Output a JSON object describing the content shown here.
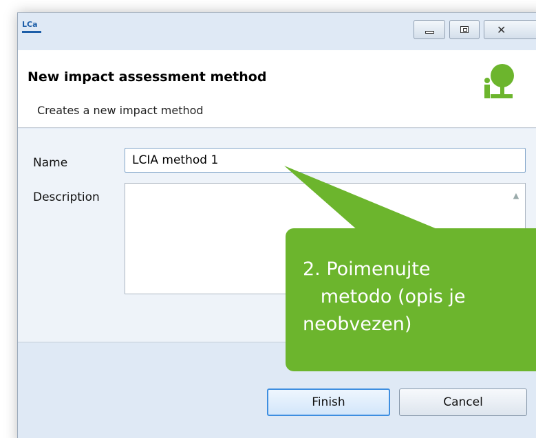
{
  "window": {
    "app_logo_text": "LCa",
    "controls": {
      "minimize": "minimize-icon",
      "maximize": "maximize-icon",
      "close": "close-icon"
    }
  },
  "header": {
    "title": "New impact assessment method",
    "subtitle": "Creates a new impact method",
    "icon": "impact-method-wizard-icon"
  },
  "form": {
    "name_label": "Name",
    "name_value": "LCIA method 1",
    "description_label": "Description",
    "description_value": ""
  },
  "buttons": {
    "finish": "Finish",
    "cancel": "Cancel"
  },
  "callout": {
    "line1": "2. Poimenujte",
    "line2": "   metodo (opis je",
    "line3": "neobvezen)",
    "color": "#6cb52d"
  }
}
